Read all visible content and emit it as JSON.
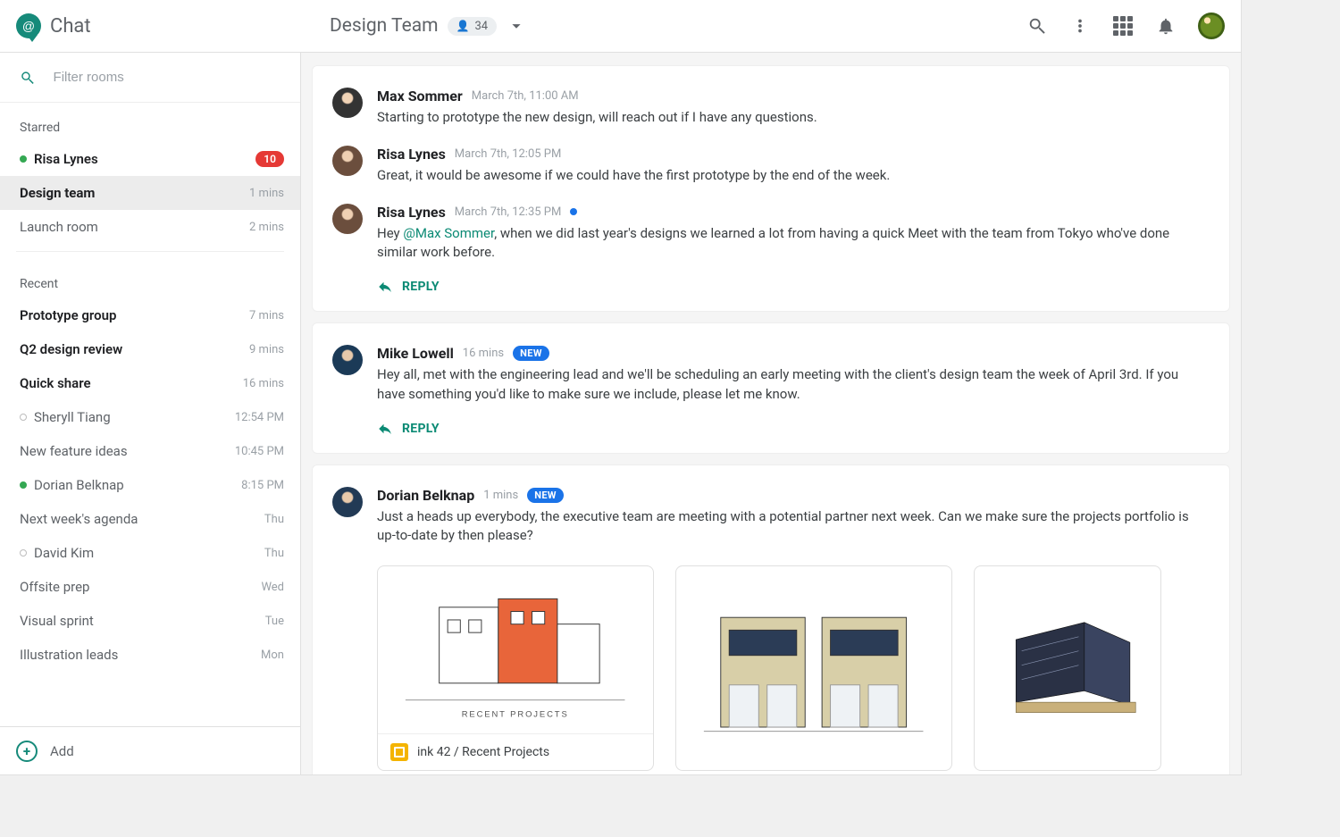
{
  "brand": {
    "name": "Chat"
  },
  "header": {
    "room_title": "Design Team",
    "member_count": "34"
  },
  "sidebar": {
    "filter_placeholder": "Filter rooms",
    "starred_label": "Starred",
    "recent_label": "Recent",
    "add_label": "Add",
    "starred": [
      {
        "name": "Risa Lynes",
        "meta": "",
        "badge": "10",
        "presence": "on",
        "bold": true
      },
      {
        "name": "Design team",
        "meta": "1 mins",
        "active": true,
        "bold": true
      },
      {
        "name": "Launch room",
        "meta": "2 mins"
      }
    ],
    "recent": [
      {
        "name": "Prototype group",
        "meta": "7 mins",
        "bold": true
      },
      {
        "name": "Q2 design review",
        "meta": "9 mins",
        "bold": true
      },
      {
        "name": "Quick share",
        "meta": "16 mins",
        "bold": true
      },
      {
        "name": "Sheryll Tiang",
        "meta": "12:54 PM",
        "presence": "off"
      },
      {
        "name": "New feature ideas",
        "meta": "10:45 PM"
      },
      {
        "name": "Dorian Belknap",
        "meta": "8:15 PM",
        "presence": "on"
      },
      {
        "name": "Next week's agenda",
        "meta": "Thu"
      },
      {
        "name": "David Kim",
        "meta": "Thu",
        "presence": "off"
      },
      {
        "name": "Offsite prep",
        "meta": "Wed"
      },
      {
        "name": "Visual sprint",
        "meta": "Tue"
      },
      {
        "name": "Illustration leads",
        "meta": "Mon"
      }
    ]
  },
  "threads": [
    {
      "messages": [
        {
          "av": "av1",
          "who": "Max Sommer",
          "time": "March 7th, 11:00 AM",
          "text": "Starting to prototype the new design, will reach out if I have any questions."
        },
        {
          "av": "av2",
          "who": "Risa Lynes",
          "time": "March 7th, 12:05 PM",
          "text": "Great, it would be awesome if we could have the first prototype by the end of the week."
        },
        {
          "av": "av2",
          "who": "Risa Lynes",
          "time": "March 7th, 12:35 PM",
          "bluedot": true,
          "pre": "Hey ",
          "mention": "@Max Sommer",
          "post": ", when we did last year's designs we learned a lot from having a quick Meet with the team from Tokyo who've done similar work before."
        }
      ],
      "reply_label": "REPLY"
    },
    {
      "messages": [
        {
          "av": "av3",
          "who": "Mike Lowell",
          "time": "16 mins",
          "new": "NEW",
          "text": "Hey all, met with the engineering lead and we'll be scheduling an early meeting with the client's design team the week of April 3rd. If you have something you'd like to make sure we include, please let me know."
        }
      ],
      "reply_label": "REPLY"
    },
    {
      "messages": [
        {
          "av": "av4",
          "who": "Dorian Belknap",
          "time": "1 mins",
          "new": "NEW",
          "text": "Just a heads up everybody, the executive team are meeting with a potential partner next week. Can we make sure the projects portfolio is up-to-date by then please?"
        }
      ],
      "attachments": {
        "slides_title": "ink 42 / Recent Projects",
        "caption_a": "RECENT PROJECTS"
      }
    }
  ]
}
